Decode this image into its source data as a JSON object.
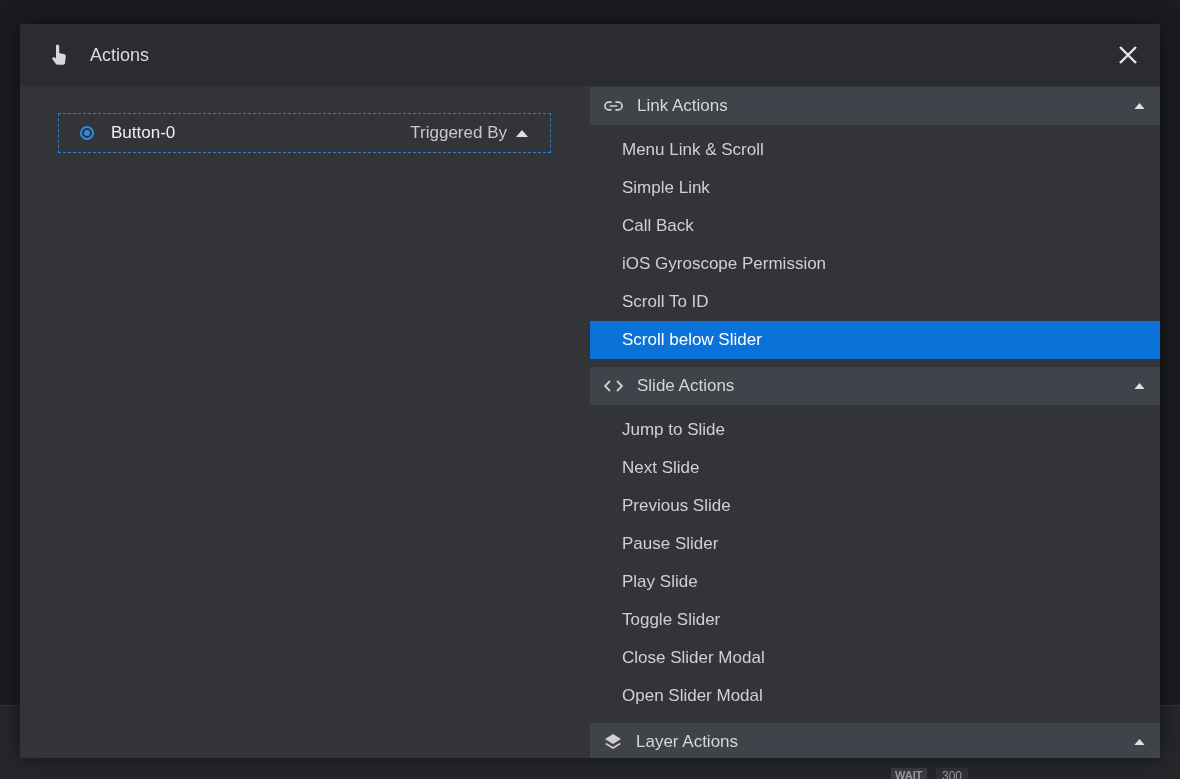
{
  "dialog": {
    "title": "Actions"
  },
  "triggers": [
    {
      "label": "Button-0",
      "selected": true,
      "dropdown": "Triggered By",
      "expanded": true
    }
  ],
  "groups": [
    {
      "kind": "link",
      "title": "Link Actions",
      "expanded": true,
      "items": [
        {
          "label": "Menu Link & Scroll",
          "selected": false
        },
        {
          "label": "Simple Link",
          "selected": false
        },
        {
          "label": "Call Back",
          "selected": false
        },
        {
          "label": "iOS Gyroscope Permission",
          "selected": false
        },
        {
          "label": "Scroll To ID",
          "selected": false
        },
        {
          "label": "Scroll below Slider",
          "selected": true
        }
      ]
    },
    {
      "kind": "slide",
      "title": "Slide Actions",
      "expanded": true,
      "items": [
        {
          "label": "Jump to Slide",
          "selected": false
        },
        {
          "label": "Next Slide",
          "selected": false
        },
        {
          "label": "Previous Slide",
          "selected": false
        },
        {
          "label": "Pause Slider",
          "selected": false
        },
        {
          "label": "Play Slide",
          "selected": false
        },
        {
          "label": "Toggle Slider",
          "selected": false
        },
        {
          "label": "Close Slider Modal",
          "selected": false
        },
        {
          "label": "Open Slider Modal",
          "selected": false
        }
      ]
    },
    {
      "kind": "layer",
      "title": "Layer Actions",
      "expanded": true
    }
  ],
  "background_timeline": {
    "wait_label": "WAIT",
    "wait_value": "300"
  }
}
